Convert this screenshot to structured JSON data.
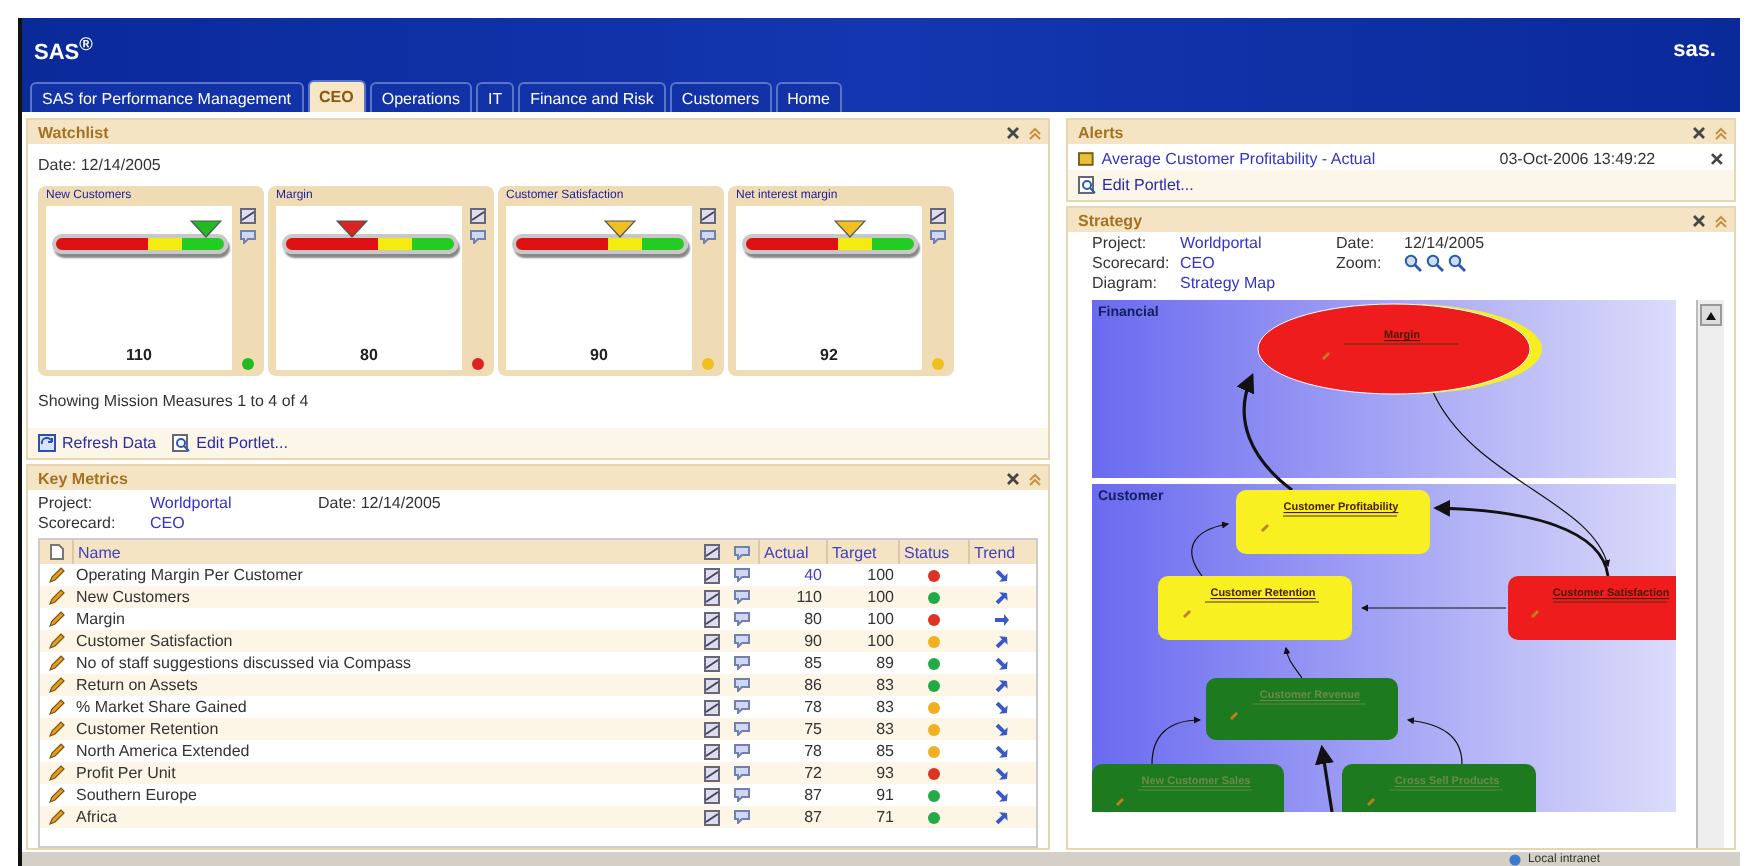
{
  "header": {
    "logo": "SAS$^{®}$",
    "brand": "sas."
  },
  "tabs": [
    {
      "label": "SAS for Performance Management",
      "selected": false
    },
    {
      "label": "CEO",
      "selected": true
    },
    {
      "label": "Operations",
      "selected": false
    },
    {
      "label": "IT",
      "selected": false
    },
    {
      "label": "Finance and Risk",
      "selected": false
    },
    {
      "label": "Customers",
      "selected": false
    },
    {
      "label": "Home",
      "selected": false
    }
  ],
  "watchlist": {
    "title": "Watchlist",
    "date": "Date: 12/14/2005",
    "gauges": [
      {
        "title": "New Customers",
        "value": "110",
        "level": 0.9,
        "color": "#22bb22"
      },
      {
        "title": "Margin",
        "value": "80",
        "level": 0.4,
        "color": "#dd2222"
      },
      {
        "title": "Customer Satisfaction",
        "value": "90",
        "level": 0.62,
        "color": "#f0c020"
      },
      {
        "title": "Net interest margin",
        "value": "92",
        "level": 0.62,
        "color": "#f0c020"
      }
    ],
    "summary": "Showing Mission Measures 1 to 4 of 4",
    "actions": [
      {
        "kind": "refresh",
        "label": "Refresh Data"
      },
      {
        "kind": "edit",
        "label": "Edit Portlet..."
      }
    ]
  },
  "key_metrics": {
    "title": "Key Metrics",
    "project_label": "Project:",
    "project": "Worldportal",
    "date": "Date: 12/14/2005",
    "scorecard_label": "Scorecard:",
    "scorecard": "CEO",
    "columns": [
      "Name",
      "Actual",
      "Target",
      "Status",
      "Trend"
    ],
    "rows": [
      {
        "name": "Operating Margin Per Customer",
        "actual": "40",
        "target": "100",
        "color": "#dd3322",
        "kind": "down",
        "link": true
      },
      {
        "name": "New Customers",
        "actual": "110",
        "target": "100",
        "color": "#22aa44",
        "kind": "up",
        "link": false
      },
      {
        "name": "Margin",
        "actual": "80",
        "target": "100",
        "color": "#dd3322",
        "kind": "right",
        "link": false
      },
      {
        "name": "Customer Satisfaction",
        "actual": "90",
        "target": "100",
        "color": "#f0b020",
        "kind": "up",
        "link": false
      },
      {
        "name": "No of staff suggestions discussed via Compass",
        "actual": "85",
        "target": "89",
        "color": "#22aa44",
        "kind": "down",
        "link": false
      },
      {
        "name": "Return on Assets",
        "actual": "86",
        "target": "83",
        "color": "#22aa44",
        "kind": "up",
        "link": false
      },
      {
        "name": "% Market Share Gained",
        "actual": "78",
        "target": "83",
        "color": "#f0b020",
        "kind": "down",
        "link": false
      },
      {
        "name": "Customer Retention",
        "actual": "75",
        "target": "83",
        "color": "#f0b020",
        "kind": "down",
        "link": false
      },
      {
        "name": "North America Extended",
        "actual": "78",
        "target": "85",
        "color": "#f0b020",
        "kind": "down",
        "link": false
      },
      {
        "name": "Profit Per Unit",
        "actual": "72",
        "target": "93",
        "color": "#dd3322",
        "kind": "down",
        "link": false
      },
      {
        "name": "Southern Europe",
        "actual": "87",
        "target": "91",
        "color": "#22aa44",
        "kind": "down",
        "link": false
      },
      {
        "name": "Africa",
        "actual": "87",
        "target": "71",
        "color": "#22aa44",
        "kind": "up",
        "link": false
      }
    ]
  },
  "alerts": {
    "title": "Alerts",
    "items": [
      {
        "text": "Average Customer Profitability - Actual",
        "time": "03-Oct-2006 13:49:22"
      }
    ],
    "action": "Edit Portlet..."
  },
  "strategy": {
    "title": "Strategy",
    "project_label": "Project:",
    "project": "Worldportal",
    "date_label": "Date:",
    "date": "12/14/2005",
    "scorecard_label": "Scorecard:",
    "scorecard": "CEO",
    "zoom_label": "Zoom:",
    "diagram_label": "Diagram:",
    "diagram": "Strategy Map",
    "lanes": [
      "Financial",
      "Customer"
    ],
    "nodes": [
      {
        "label": "Margin",
        "color": "#ee1c1c"
      },
      {
        "label": "Customer Profitability",
        "color": "#f8f020"
      },
      {
        "label": "Customer Retention",
        "color": "#f8f020"
      },
      {
        "label": "Customer Satisfaction",
        "color": "#ee1c1c"
      },
      {
        "label": "Customer Revenue",
        "color": "#1e7a1e"
      },
      {
        "label": "New Customer Sales",
        "color": "#1e7a1e"
      },
      {
        "label": "Cross Sell Products",
        "color": "#1e7a1e"
      }
    ]
  },
  "status_bar": {
    "zone": "Local intranet"
  }
}
